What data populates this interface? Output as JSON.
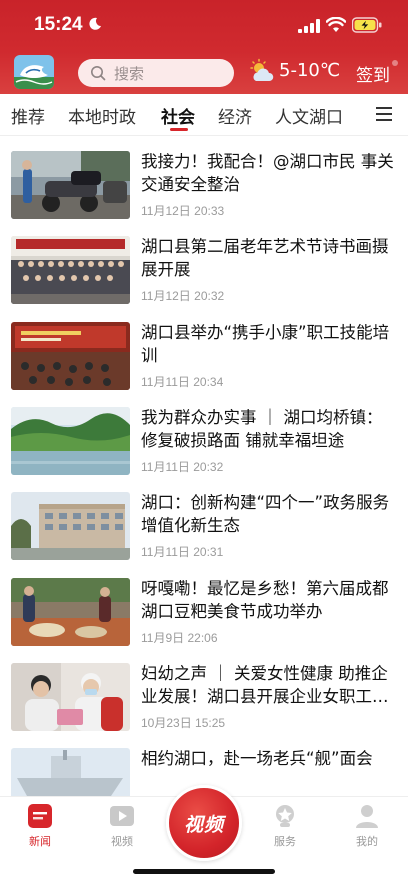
{
  "status_bar": {
    "time": "15:24"
  },
  "header": {
    "search_placeholder": "搜索",
    "weather": "5-10℃",
    "signin_label": "签到"
  },
  "tabs": [
    {
      "label": "推荐",
      "active": false
    },
    {
      "label": "本地时政",
      "active": false
    },
    {
      "label": "社会",
      "active": true
    },
    {
      "label": "经济",
      "active": false
    },
    {
      "label": "人文湖口",
      "active": false
    }
  ],
  "news": [
    {
      "title": "我接力！我配合！@湖口市民 事关交通安全整治",
      "time": "11月12日 20:33"
    },
    {
      "title": "湖口县第二届老年艺术节诗书画摄展开展",
      "time": "11月12日 20:32"
    },
    {
      "title": "湖口县举办“携手小康”职工技能培训",
      "time": "11月11日 20:34"
    },
    {
      "title": "我为群众办实事 ｜ 湖口均桥镇：修复破损路面 铺就幸福坦途",
      "time": "11月11日 20:32"
    },
    {
      "title": "湖口：创新构建“四个一”政务服务增值化新生态",
      "time": "11月11日 20:31"
    },
    {
      "title": "呀嘎嘞！最忆是乡愁！第六届成都湖口豆粑美食节成功举办",
      "time": "11月9日 22:06"
    },
    {
      "title": "妇幼之声 ｜ 关爱女性健康 助推企业发展！湖口县开展企业女职工健康讲座",
      "time": "10月23日 15:25"
    },
    {
      "title": "相约湖口，赴一场老兵“舰”面会",
      "time": ""
    }
  ],
  "bottom_nav": [
    {
      "label": "新闻",
      "icon": "news-icon",
      "active": true
    },
    {
      "label": "视频",
      "icon": "video-icon",
      "active": false
    },
    {
      "label": "视频",
      "icon": "video-fab",
      "active": false
    },
    {
      "label": "服务",
      "icon": "service-icon",
      "active": false
    },
    {
      "label": "我的",
      "icon": "profile-icon",
      "active": false
    }
  ],
  "colors": {
    "brand_red": "#d7262b",
    "header_red": "#c9232a",
    "time_gray": "#9b9b9b"
  }
}
